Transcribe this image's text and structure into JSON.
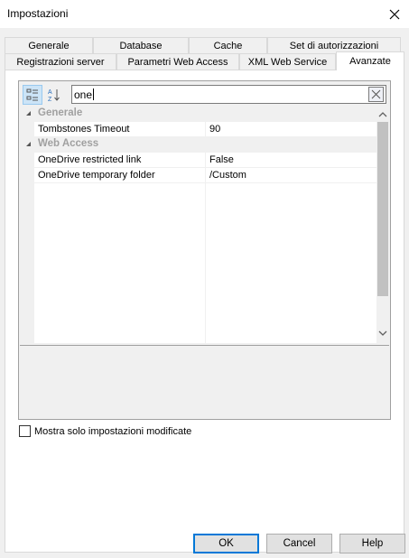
{
  "window": {
    "title": "Impostazioni"
  },
  "tabs": {
    "row1": [
      {
        "label": "Generale"
      },
      {
        "label": "Database"
      },
      {
        "label": "Cache"
      },
      {
        "label": "Set di autorizzazioni"
      }
    ],
    "row2": [
      {
        "label": "Registrazioni server"
      },
      {
        "label": "Parametri Web Access"
      },
      {
        "label": "XML Web Service"
      },
      {
        "label": "Avanzate",
        "active": true
      }
    ]
  },
  "search": {
    "value": "one"
  },
  "grid": {
    "categories": [
      {
        "label": "Generale",
        "properties": [
          {
            "name": "Tombstones Timeout",
            "value": "90"
          }
        ]
      },
      {
        "label": "Web Access",
        "properties": [
          {
            "name": "OneDrive restricted link",
            "value": "False"
          },
          {
            "name": "OneDrive temporary folder",
            "value": "/Custom"
          }
        ]
      }
    ]
  },
  "options": {
    "show_modified_only": "Mostra solo impostazioni modificate"
  },
  "buttons": {
    "ok": "OK",
    "cancel": "Cancel",
    "help": "Help"
  },
  "icons": {
    "close": "close-icon",
    "categorized": "categorized-view-icon",
    "alphabetical": "sort-az-icon",
    "clear_search": "clear-search-icon",
    "collapse": "collapse-triangle-icon",
    "scroll_up": "scroll-up-arrow-icon",
    "scroll_down": "scroll-down-arrow-icon"
  },
  "colors": {
    "accent": "#0078d7",
    "category_text": "#a0a0a0",
    "selected_toolbar": "#cce4f7"
  }
}
